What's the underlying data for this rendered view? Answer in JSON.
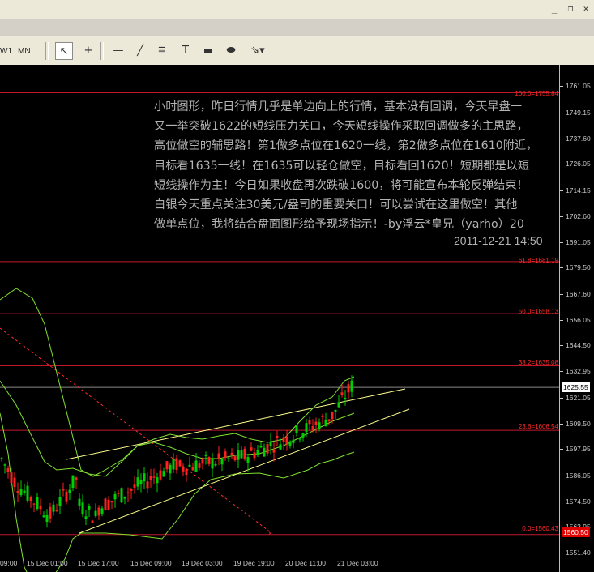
{
  "window": {
    "minimize_glyph": "_",
    "restore_glyph": "❐",
    "close_glyph": "✕"
  },
  "toolbar": {
    "timeframes": [
      "W1",
      "MN"
    ],
    "tools": [
      {
        "name": "cursor-tool",
        "icon": "arrow-cursor-icon",
        "glyph": "↖",
        "active": true
      },
      {
        "name": "crosshair-tool",
        "icon": "crosshair-icon",
        "glyph": "+"
      },
      {
        "name": "horizontal-line-tool",
        "icon": "horizontal-line-icon",
        "glyph": "—"
      },
      {
        "name": "trendline-tool",
        "icon": "trendline-icon",
        "glyph": "╱"
      },
      {
        "name": "fibonacci-tool",
        "icon": "fibonacci-icon",
        "glyph": "≣"
      },
      {
        "name": "text-label-tool",
        "icon": "text-label-icon",
        "glyph": "T"
      },
      {
        "name": "rectangle-tool",
        "icon": "rectangle-icon",
        "glyph": "▬"
      },
      {
        "name": "ellipse-tool",
        "icon": "ellipse-icon",
        "glyph": "⬬"
      },
      {
        "name": "arrows-tool",
        "icon": "arrows-icon",
        "glyph": "⇘▾"
      }
    ]
  },
  "annotation": {
    "lines": [
      "小时图形，昨日行情几乎是单边向上的行情，基本没有回调，今天早盘一",
      "又一举突破1622的短线压力关口，今天短线操作采取回调做多的主思路，",
      "高位做空的辅思路！第1做多点位在1620一线，第2做多点位在1610附近，",
      "目标看1635一线！在1635可以轻仓做空，目标看回1620！短期都是以短",
      "短线操作为主！今日如果收盘再次跌破1600，将可能宣布本轮反弹结束！",
      "白银今天重点关注30美元/盎司的重要关口！可以尝试在这里做空！其他",
      "做单点位，我将结合盘面图形给予现场指示！-by浮云*皇兄（yarho）20"
    ],
    "timestamp": "2011-12-21 14:50"
  },
  "fib_levels": [
    {
      "label": "100.0=1755.84",
      "price": 1755.84
    },
    {
      "label": "61.8=1681.19",
      "price": 1681.19
    },
    {
      "label": "50.0=1658.13",
      "price": 1658.13
    },
    {
      "label": "38.2=1635.08",
      "price": 1635.08
    },
    {
      "label": "23.6=1606.54",
      "price": 1606.54
    },
    {
      "label": "0.0=1560.43",
      "price": 1560.43
    }
  ],
  "price_axis": {
    "ticks": [
      "1761.05",
      "1749.15",
      "1737.60",
      "1726.05",
      "1714.15",
      "1702.60",
      "1691.05",
      "1679.50",
      "1667.60",
      "1656.05",
      "1644.50",
      "1632.95",
      "1621.05",
      "1609.50",
      "1597.95",
      "1586.05",
      "1574.50",
      "1562.95",
      "1551.40"
    ],
    "current_price": "1625.55",
    "low_marker": "1560.50",
    "range": [
      1551.4,
      1761.05
    ]
  },
  "time_axis": {
    "labels": [
      "09:00",
      "15 Dec 01:00",
      "15 Dec 17:00",
      "16 Dec 09:00",
      "19 Dec 03:00",
      "19 Dec 19:00",
      "20 Dec 11:00",
      "21 Dec 03:00"
    ]
  },
  "colors": {
    "background": "#000000",
    "bull_candle": "#00d000",
    "bear_candle": "#ff2020",
    "fib_line": "#c0182a",
    "trend_line": "#ffff8c",
    "bollinger": "#7fe030",
    "projection": "#ff2a2a",
    "text": "#b3b3b3"
  }
}
